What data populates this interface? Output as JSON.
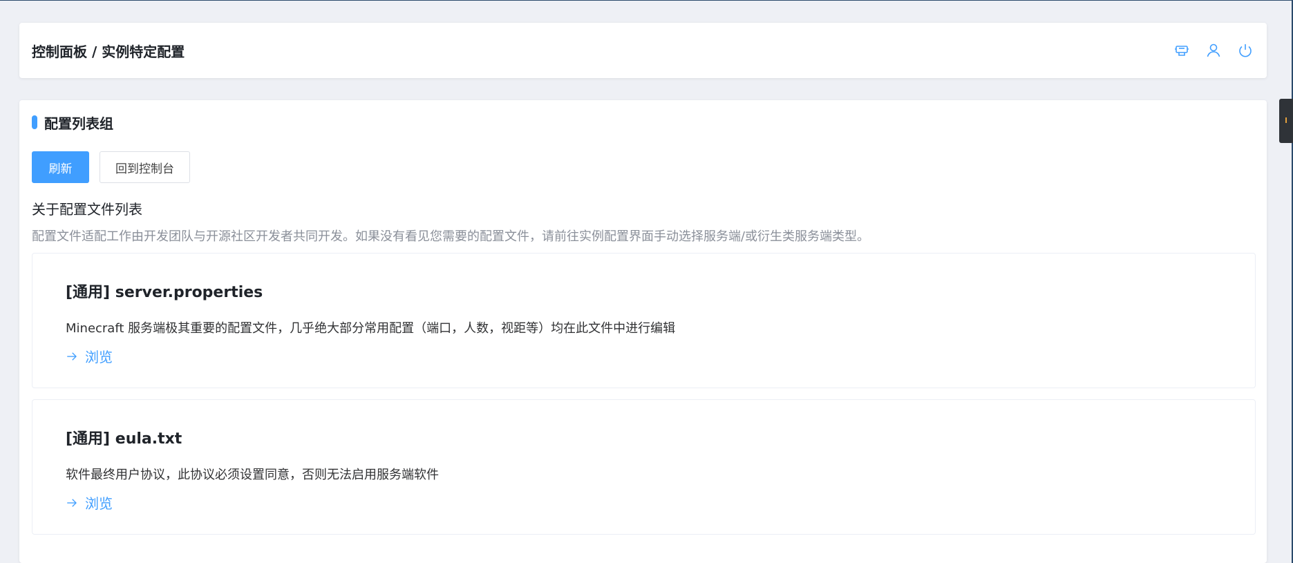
{
  "header": {
    "breadcrumb": "控制面板 / 实例特定配置",
    "icons": [
      "terminal-icon",
      "user-icon",
      "power-icon"
    ]
  },
  "card": {
    "title": "配置列表组",
    "buttons": {
      "refresh": "刷新",
      "back": "回到控制台"
    },
    "about_title": "关于配置文件列表",
    "about_desc": "配置文件适配工作由开发团队与开源社区开发者共同开发。如果没有看见您需要的配置文件，请前往实例配置界面手动选择服务端/或衍生类服务端类型。",
    "items": [
      {
        "title": "[通用] server.properties",
        "desc": "Minecraft 服务端极其重要的配置文件，几乎绝大部分常用配置（端口，人数，视距等）均在此文件中进行编辑",
        "link": "浏览"
      },
      {
        "title": "[通用] eula.txt",
        "desc": "软件最终用户协议，此协议必须设置同意，否则无法启用服务端软件",
        "link": "浏览"
      }
    ]
  },
  "colors": {
    "accent": "#409eff",
    "background": "#eef0f5"
  }
}
